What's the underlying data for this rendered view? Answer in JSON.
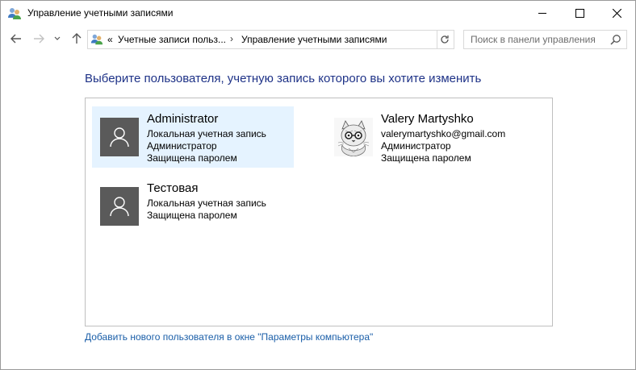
{
  "window": {
    "title": "Управление учетными записями"
  },
  "address": {
    "overflow": "«",
    "crumbs": [
      "Учетные записи польз...",
      "Управление учетными записями"
    ]
  },
  "search": {
    "placeholder": "Поиск в панели управления"
  },
  "main": {
    "heading": "Выберите пользователя, учетную запись которого вы хотите изменить",
    "accounts": [
      {
        "name": "Administrator",
        "lines": [
          "Локальная учетная запись",
          "Администратор",
          "Защищена паролем"
        ],
        "selected": true,
        "avatar": "user-silhouette-icon"
      },
      {
        "name": "Valery Martyshko",
        "lines": [
          "valerymartyshko@gmail.com",
          "Администратор",
          "Защищена паролем"
        ],
        "selected": false,
        "avatar": "cat-photo"
      },
      {
        "name": "Тестовая",
        "lines": [
          "Локальная учетная запись",
          "Защищена паролем"
        ],
        "selected": false,
        "avatar": "user-silhouette-icon"
      }
    ],
    "add_user_link": "Добавить нового пользователя в окне \"Параметры компьютера\""
  },
  "colors": {
    "heading": "#1e3287",
    "link": "#1a5ea8",
    "selected_tile": "#e5f3ff",
    "avatar_bg": "#5a5a5a"
  }
}
